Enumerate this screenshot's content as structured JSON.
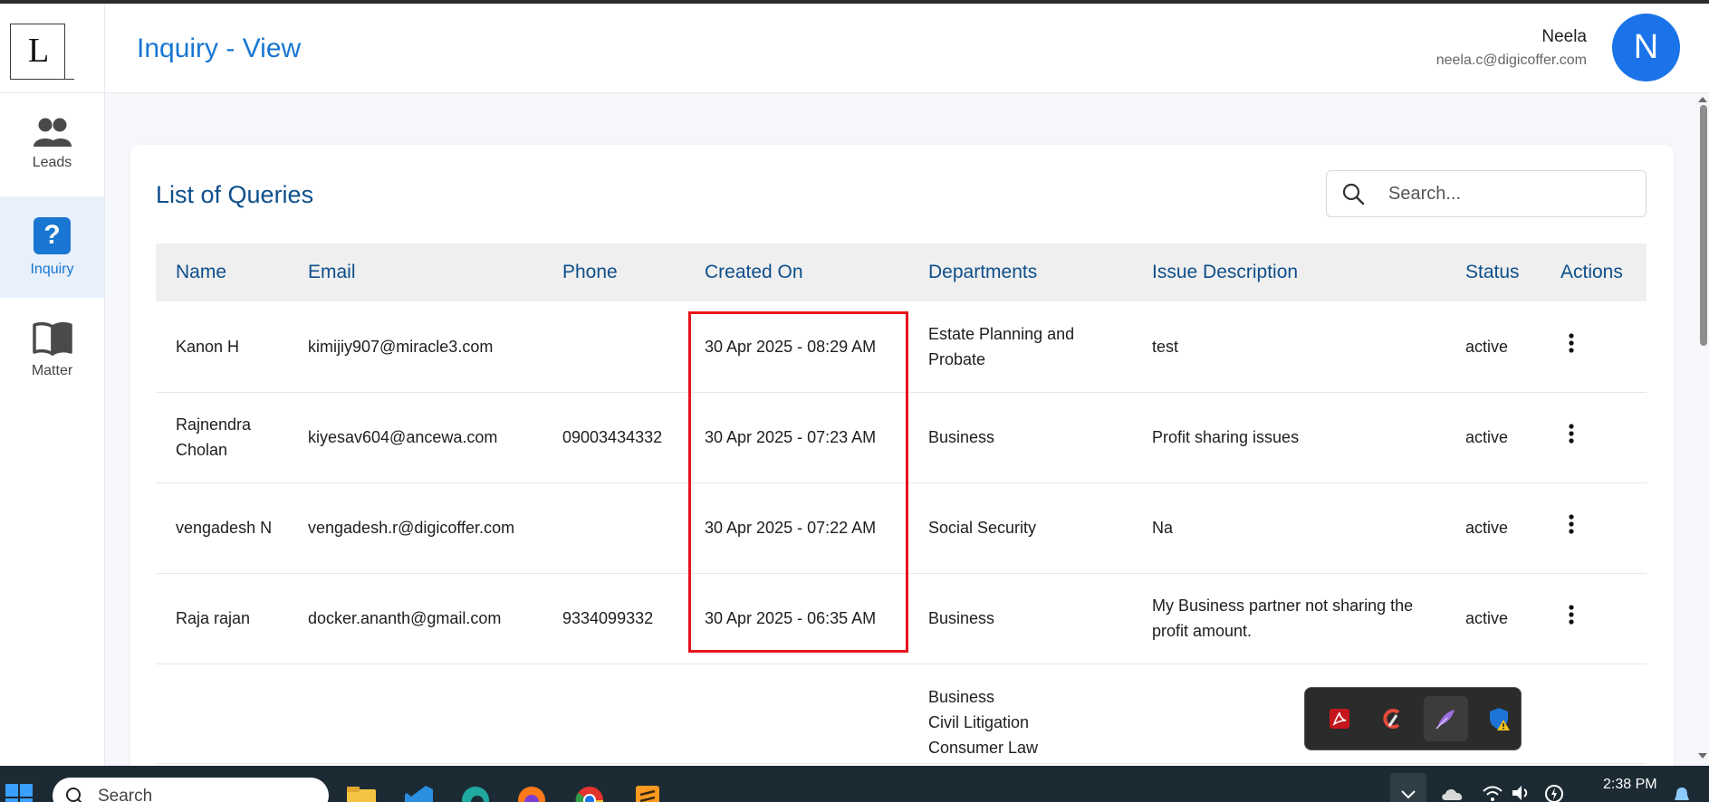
{
  "sidebar": {
    "logo_letter": "L",
    "items": [
      {
        "label": "Leads",
        "icon": "people-icon"
      },
      {
        "label": "Inquiry",
        "icon": "question-icon",
        "active": true,
        "badge": "?"
      },
      {
        "label": "Matter",
        "icon": "book-icon"
      }
    ]
  },
  "header": {
    "title": "Inquiry - View",
    "user": {
      "name": "Neela",
      "email": "neela.c@digicoffer.com",
      "initial": "N"
    }
  },
  "card": {
    "title": "List of Queries",
    "search": {
      "placeholder": "Search...",
      "value": ""
    }
  },
  "table": {
    "columns": [
      "Name",
      "Email",
      "Phone",
      "Created On",
      "Departments",
      "Issue Description",
      "Status",
      "Actions"
    ],
    "rows": [
      {
        "name": "Kanon H",
        "email": "kimijiy907@miracle3.com",
        "phone": "",
        "created_on": "30 Apr 2025 - 08:29 AM",
        "departments": [
          "Estate Planning and Probate"
        ],
        "issue": "test",
        "status": "active"
      },
      {
        "name": "Rajnendra Cholan",
        "email": "kiyesav604@ancewa.com",
        "phone": "09003434332",
        "created_on": "30 Apr 2025 - 07:23 AM",
        "departments": [
          "Business"
        ],
        "issue": "Profit sharing issues",
        "status": "active"
      },
      {
        "name": "vengadesh N",
        "email": "vengadesh.r@digicoffer.com",
        "phone": "",
        "created_on": "30 Apr 2025 - 07:22 AM",
        "departments": [
          "Social Security"
        ],
        "issue": "Na",
        "status": "active"
      },
      {
        "name": "Raja rajan",
        "email": "docker.ananth@gmail.com",
        "phone": "9334099332",
        "created_on": "30 Apr 2025 - 06:35 AM",
        "departments": [
          "Business"
        ],
        "issue": "My Business partner not sharing the profit amount.",
        "status": "active"
      },
      {
        "name": "",
        "email": "",
        "phone": "",
        "created_on": "",
        "departments": [
          "Business",
          "Civil Litigation",
          "Consumer Law"
        ],
        "issue": "",
        "status": ""
      }
    ]
  },
  "taskbar": {
    "search_label": "Search",
    "clock": "2:38 PM"
  },
  "colors": {
    "accent": "#1976d2",
    "title_blue": "#0d4f8b",
    "highlight": "#e5141b",
    "avatar": "#1a73e8"
  }
}
